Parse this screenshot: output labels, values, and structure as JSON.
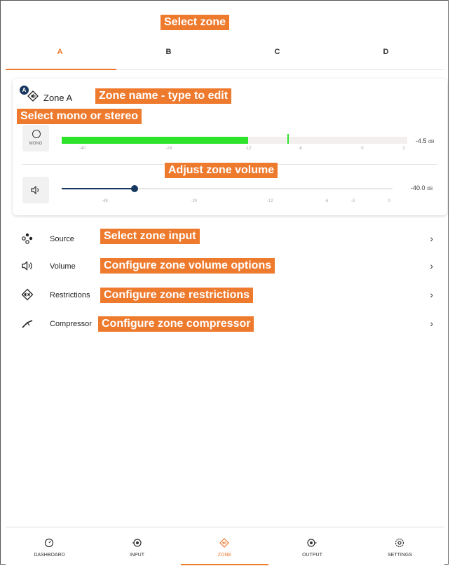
{
  "callouts": {
    "select_zone": "Select zone",
    "zone_name": "Zone name - type to edit",
    "mono_stereo": "Select mono or stereo",
    "adjust_volume": "Adjust zone volume",
    "zone_input": "Select zone input",
    "volume_options": "Configure zone volume options",
    "restrictions": "Configure zone restrictions",
    "compressor": "Configure zone compressor"
  },
  "tabs": [
    {
      "label": "A",
      "active": true
    },
    {
      "label": "B",
      "active": false
    },
    {
      "label": "C",
      "active": false
    },
    {
      "label": "D",
      "active": false
    }
  ],
  "zone": {
    "badge": "A",
    "name": "Zone A",
    "mono_label": "MONO",
    "meter": {
      "level_db": -12,
      "peak_db": -7.5,
      "readout": "-4.5",
      "unit": "dB",
      "ticks": [
        "-40",
        "-24",
        "-12",
        "-6",
        "0",
        "3"
      ]
    },
    "volume": {
      "value_db": -40.0,
      "readout": "-40.0",
      "unit": "dB",
      "ticks": [
        "-48",
        "-24",
        "-12",
        "-6",
        "-3",
        "0"
      ]
    }
  },
  "menu": [
    {
      "label": "Source",
      "icon": "source-icon"
    },
    {
      "label": "Volume",
      "icon": "volume-icon"
    },
    {
      "label": "Restrictions",
      "icon": "restrictions-icon"
    },
    {
      "label": "Compressor",
      "icon": "compressor-icon"
    }
  ],
  "nav": [
    {
      "label": "DASHBOARD",
      "icon": "dashboard-icon",
      "active": false
    },
    {
      "label": "INPUT",
      "icon": "input-icon",
      "active": false
    },
    {
      "label": "ZONE",
      "icon": "zone-icon",
      "active": true
    },
    {
      "label": "OUTPUT",
      "icon": "output-icon",
      "active": false
    },
    {
      "label": "SETTINGS",
      "icon": "settings-icon",
      "active": false
    }
  ],
  "colors": {
    "accent": "#ee7a2e",
    "meter": "#2ee42b",
    "navy": "#17385f"
  }
}
